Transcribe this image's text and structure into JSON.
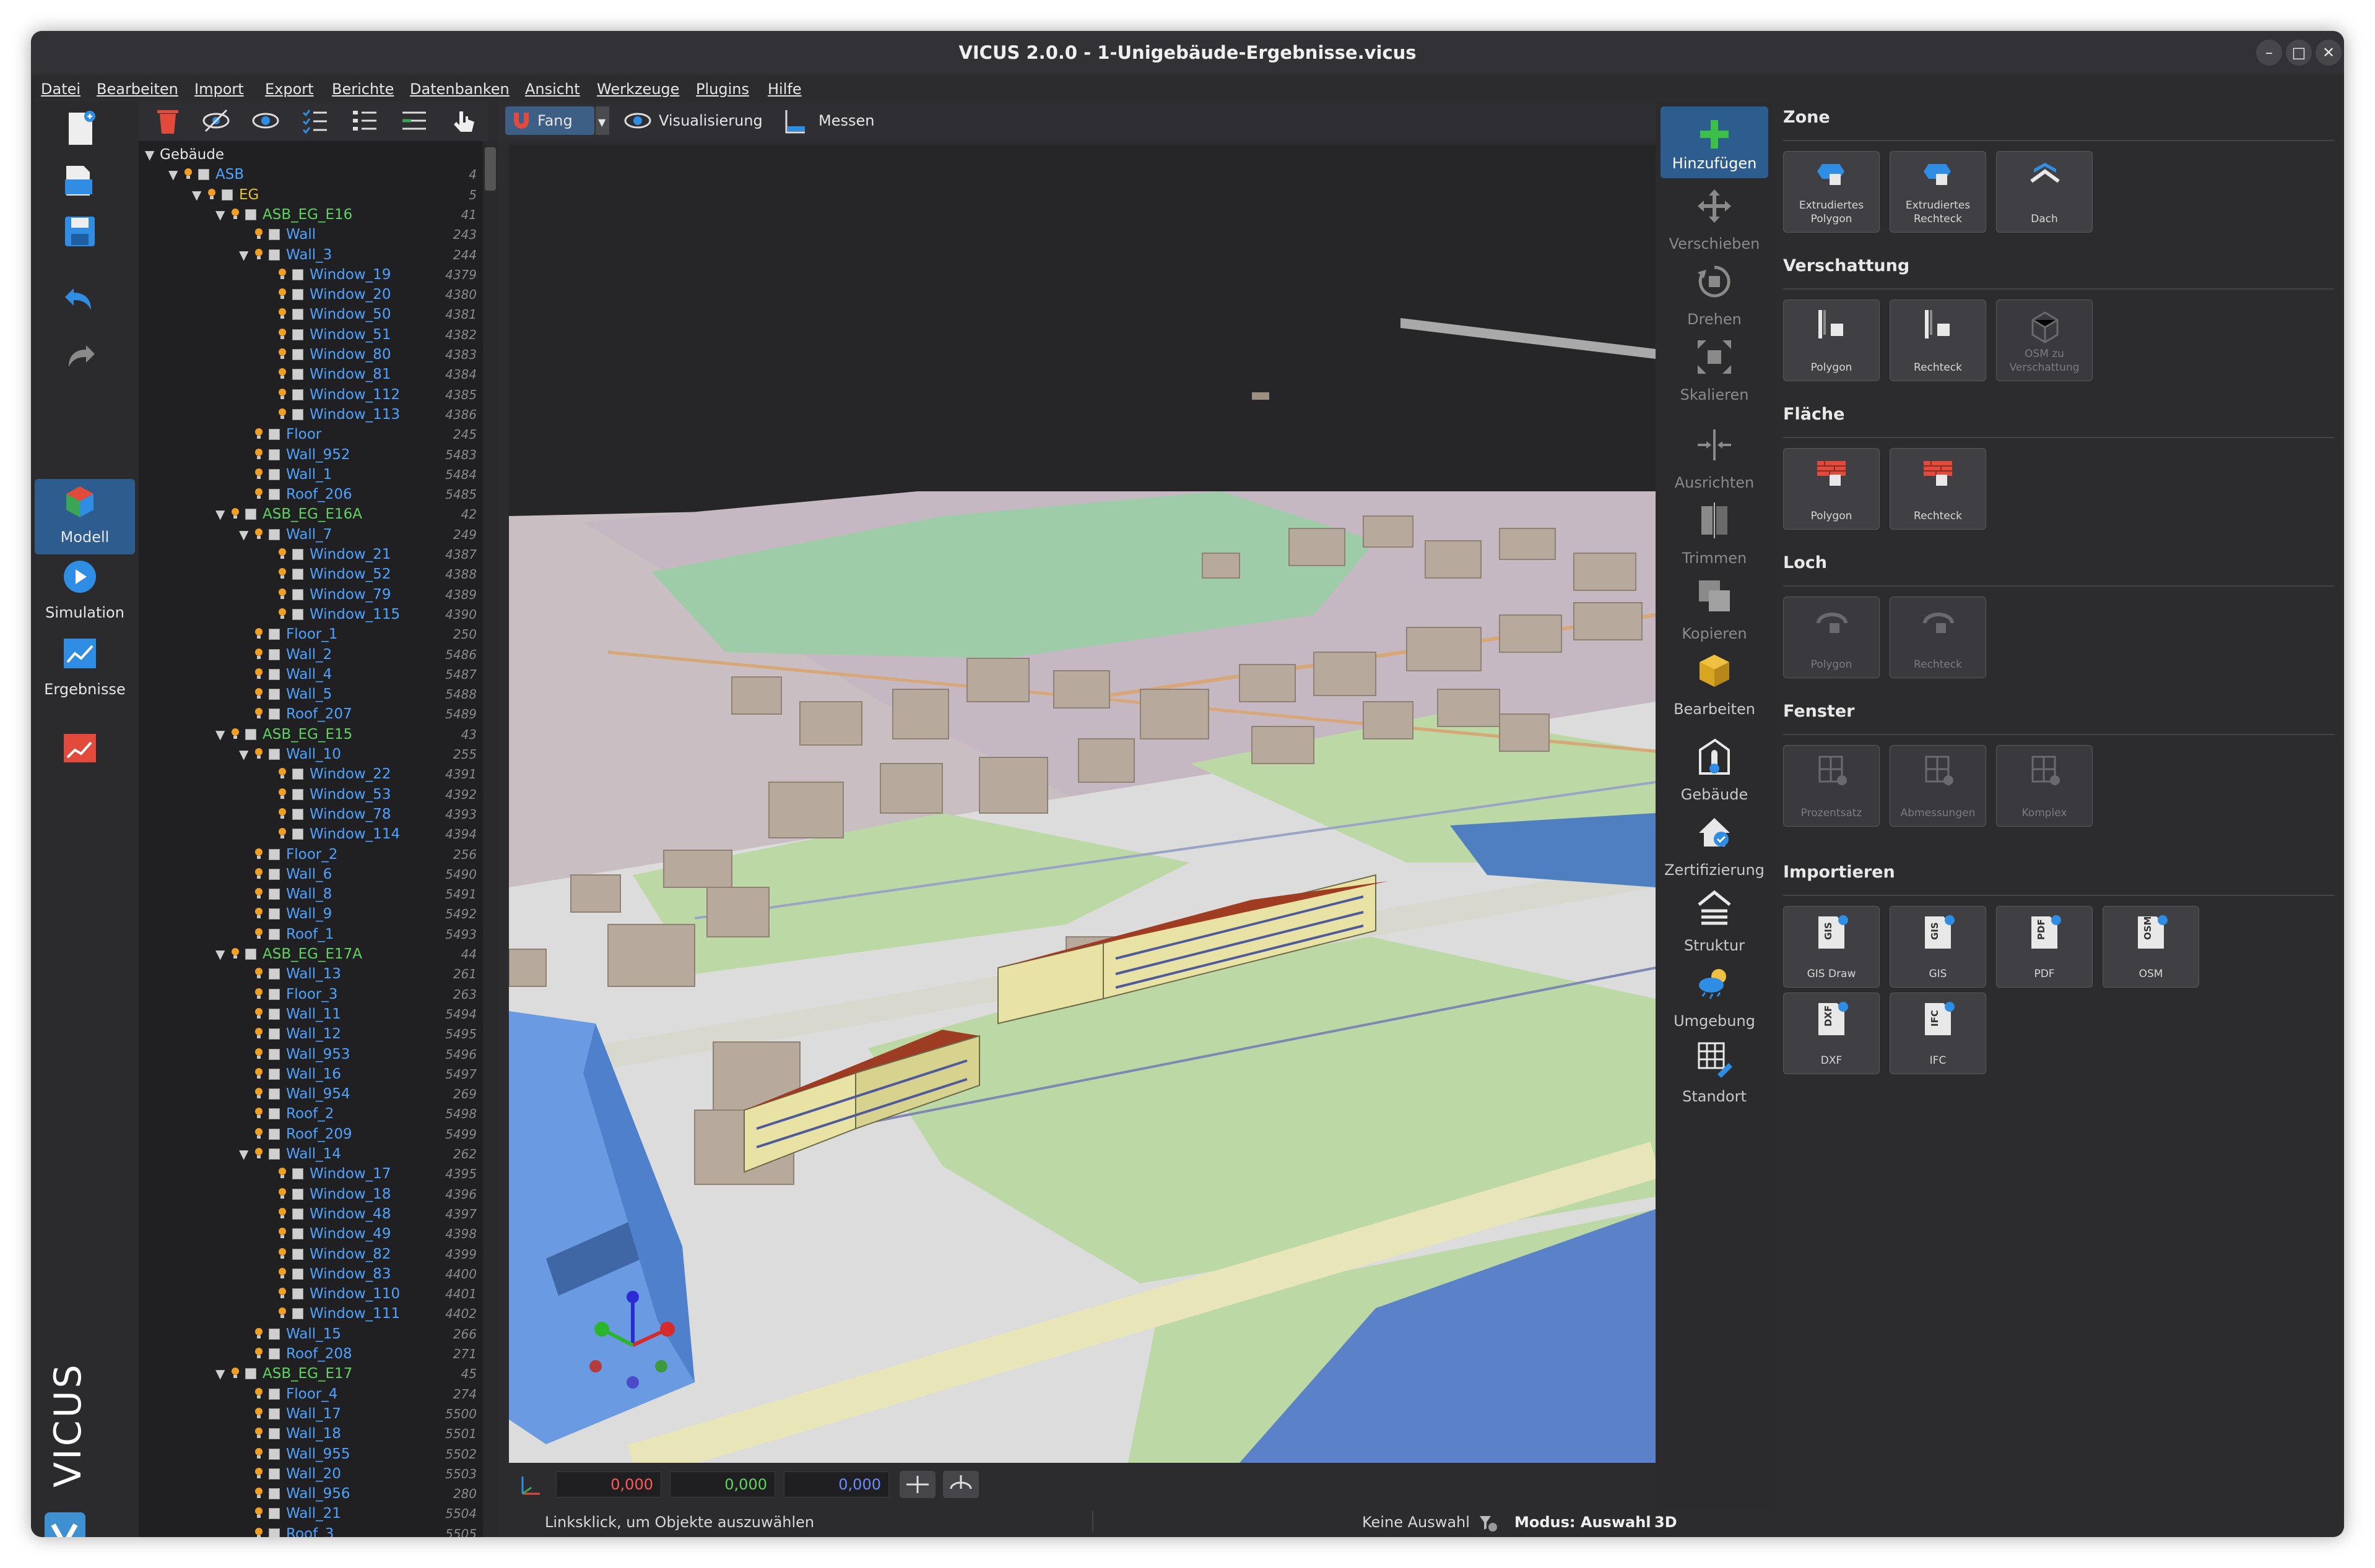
{
  "window": {
    "title": "VICUS 2.0.0 - 1-Unigebäude-Ergebnisse.vicus",
    "controls": [
      "–",
      "□",
      "✕"
    ]
  },
  "menu": [
    "Datei",
    "Bearbeiten",
    "Import",
    "Export",
    "Berichte",
    "Datenbanken",
    "Ansicht",
    "Werkzeuge",
    "Plugins",
    "Hilfe"
  ],
  "left_toolbar": {
    "modes": [
      "Modell",
      "Simulation",
      "Ergebnisse"
    ],
    "brand": "VICUS"
  },
  "view_toolbar": {
    "snap_label": "Fang",
    "visualization_label": "Visualisierung",
    "measure_label": "Messen"
  },
  "tree": [
    {
      "label": "Gebäude",
      "num": "",
      "level": 0,
      "arrow": true,
      "bulb": false,
      "box": false,
      "color": "#e6e6e6"
    },
    {
      "label": "ASB",
      "num": "4",
      "level": 1,
      "arrow": true,
      "bulb": true,
      "box": true,
      "color": "#4da3ff"
    },
    {
      "label": "EG",
      "num": "5",
      "level": 2,
      "arrow": true,
      "bulb": true,
      "box": true,
      "color": "#e6c229"
    },
    {
      "label": "ASB_EG_E16",
      "num": "41",
      "level": 3,
      "arrow": true,
      "bulb": true,
      "box": true,
      "color": "#5fd35f"
    },
    {
      "label": "Wall",
      "num": "243",
      "level": 4,
      "arrow": false,
      "bulb": true,
      "box": true,
      "color": "#4da3ff"
    },
    {
      "label": "Wall_3",
      "num": "244",
      "level": 4,
      "arrow": true,
      "bulb": true,
      "box": true,
      "color": "#4da3ff"
    },
    {
      "label": "Window_19",
      "num": "4379",
      "level": 5,
      "arrow": false,
      "bulb": true,
      "box": true,
      "color": "#4da3ff"
    },
    {
      "label": "Window_20",
      "num": "4380",
      "level": 5,
      "arrow": false,
      "bulb": true,
      "box": true,
      "color": "#4da3ff"
    },
    {
      "label": "Window_50",
      "num": "4381",
      "level": 5,
      "arrow": false,
      "bulb": true,
      "box": true,
      "color": "#4da3ff"
    },
    {
      "label": "Window_51",
      "num": "4382",
      "level": 5,
      "arrow": false,
      "bulb": true,
      "box": true,
      "color": "#4da3ff"
    },
    {
      "label": "Window_80",
      "num": "4383",
      "level": 5,
      "arrow": false,
      "bulb": true,
      "box": true,
      "color": "#4da3ff"
    },
    {
      "label": "Window_81",
      "num": "4384",
      "level": 5,
      "arrow": false,
      "bulb": true,
      "box": true,
      "color": "#4da3ff"
    },
    {
      "label": "Window_112",
      "num": "4385",
      "level": 5,
      "arrow": false,
      "bulb": true,
      "box": true,
      "color": "#4da3ff"
    },
    {
      "label": "Window_113",
      "num": "4386",
      "level": 5,
      "arrow": false,
      "bulb": true,
      "box": true,
      "color": "#4da3ff"
    },
    {
      "label": "Floor",
      "num": "245",
      "level": 4,
      "arrow": false,
      "bulb": true,
      "box": true,
      "color": "#4da3ff"
    },
    {
      "label": "Wall_952",
      "num": "5483",
      "level": 4,
      "arrow": false,
      "bulb": true,
      "box": true,
      "color": "#4da3ff"
    },
    {
      "label": "Wall_1",
      "num": "5484",
      "level": 4,
      "arrow": false,
      "bulb": true,
      "box": true,
      "color": "#4da3ff"
    },
    {
      "label": "Roof_206",
      "num": "5485",
      "level": 4,
      "arrow": false,
      "bulb": true,
      "box": true,
      "color": "#4da3ff"
    },
    {
      "label": "ASB_EG_E16A",
      "num": "42",
      "level": 3,
      "arrow": true,
      "bulb": true,
      "box": true,
      "color": "#5fd35f"
    },
    {
      "label": "Wall_7",
      "num": "249",
      "level": 4,
      "arrow": true,
      "bulb": true,
      "box": true,
      "color": "#4da3ff"
    },
    {
      "label": "Window_21",
      "num": "4387",
      "level": 5,
      "arrow": false,
      "bulb": true,
      "box": true,
      "color": "#4da3ff"
    },
    {
      "label": "Window_52",
      "num": "4388",
      "level": 5,
      "arrow": false,
      "bulb": true,
      "box": true,
      "color": "#4da3ff"
    },
    {
      "label": "Window_79",
      "num": "4389",
      "level": 5,
      "arrow": false,
      "bulb": true,
      "box": true,
      "color": "#4da3ff"
    },
    {
      "label": "Window_115",
      "num": "4390",
      "level": 5,
      "arrow": false,
      "bulb": true,
      "box": true,
      "color": "#4da3ff"
    },
    {
      "label": "Floor_1",
      "num": "250",
      "level": 4,
      "arrow": false,
      "bulb": true,
      "box": true,
      "color": "#4da3ff"
    },
    {
      "label": "Wall_2",
      "num": "5486",
      "level": 4,
      "arrow": false,
      "bulb": true,
      "box": true,
      "color": "#4da3ff"
    },
    {
      "label": "Wall_4",
      "num": "5487",
      "level": 4,
      "arrow": false,
      "bulb": true,
      "box": true,
      "color": "#4da3ff"
    },
    {
      "label": "Wall_5",
      "num": "5488",
      "level": 4,
      "arrow": false,
      "bulb": true,
      "box": true,
      "color": "#4da3ff"
    },
    {
      "label": "Roof_207",
      "num": "5489",
      "level": 4,
      "arrow": false,
      "bulb": true,
      "box": true,
      "color": "#4da3ff"
    },
    {
      "label": "ASB_EG_E15",
      "num": "43",
      "level": 3,
      "arrow": true,
      "bulb": true,
      "box": true,
      "color": "#5fd35f"
    },
    {
      "label": "Wall_10",
      "num": "255",
      "level": 4,
      "arrow": true,
      "bulb": true,
      "box": true,
      "color": "#4da3ff"
    },
    {
      "label": "Window_22",
      "num": "4391",
      "level": 5,
      "arrow": false,
      "bulb": true,
      "box": true,
      "color": "#4da3ff"
    },
    {
      "label": "Window_53",
      "num": "4392",
      "level": 5,
      "arrow": false,
      "bulb": true,
      "box": true,
      "color": "#4da3ff"
    },
    {
      "label": "Window_78",
      "num": "4393",
      "level": 5,
      "arrow": false,
      "bulb": true,
      "box": true,
      "color": "#4da3ff"
    },
    {
      "label": "Window_114",
      "num": "4394",
      "level": 5,
      "arrow": false,
      "bulb": true,
      "box": true,
      "color": "#4da3ff"
    },
    {
      "label": "Floor_2",
      "num": "256",
      "level": 4,
      "arrow": false,
      "bulb": true,
      "box": true,
      "color": "#4da3ff"
    },
    {
      "label": "Wall_6",
      "num": "5490",
      "level": 4,
      "arrow": false,
      "bulb": true,
      "box": true,
      "color": "#4da3ff"
    },
    {
      "label": "Wall_8",
      "num": "5491",
      "level": 4,
      "arrow": false,
      "bulb": true,
      "box": true,
      "color": "#4da3ff"
    },
    {
      "label": "Wall_9",
      "num": "5492",
      "level": 4,
      "arrow": false,
      "bulb": true,
      "box": true,
      "color": "#4da3ff"
    },
    {
      "label": "Roof_1",
      "num": "5493",
      "level": 4,
      "arrow": false,
      "bulb": true,
      "box": true,
      "color": "#4da3ff"
    },
    {
      "label": "ASB_EG_E17A",
      "num": "44",
      "level": 3,
      "arrow": true,
      "bulb": true,
      "box": true,
      "color": "#5fd35f"
    },
    {
      "label": "Wall_13",
      "num": "261",
      "level": 4,
      "arrow": false,
      "bulb": true,
      "box": true,
      "color": "#4da3ff"
    },
    {
      "label": "Floor_3",
      "num": "263",
      "level": 4,
      "arrow": false,
      "bulb": true,
      "box": true,
      "color": "#4da3ff"
    },
    {
      "label": "Wall_11",
      "num": "5494",
      "level": 4,
      "arrow": false,
      "bulb": true,
      "box": true,
      "color": "#4da3ff"
    },
    {
      "label": "Wall_12",
      "num": "5495",
      "level": 4,
      "arrow": false,
      "bulb": true,
      "box": true,
      "color": "#4da3ff"
    },
    {
      "label": "Wall_953",
      "num": "5496",
      "level": 4,
      "arrow": false,
      "bulb": true,
      "box": true,
      "color": "#4da3ff"
    },
    {
      "label": "Wall_16",
      "num": "5497",
      "level": 4,
      "arrow": false,
      "bulb": true,
      "box": true,
      "color": "#4da3ff"
    },
    {
      "label": "Wall_954",
      "num": "269",
      "level": 4,
      "arrow": false,
      "bulb": true,
      "box": true,
      "color": "#4da3ff"
    },
    {
      "label": "Roof_2",
      "num": "5498",
      "level": 4,
      "arrow": false,
      "bulb": true,
      "box": true,
      "color": "#4da3ff"
    },
    {
      "label": "Roof_209",
      "num": "5499",
      "level": 4,
      "arrow": false,
      "bulb": true,
      "box": true,
      "color": "#4da3ff"
    },
    {
      "label": "Wall_14",
      "num": "262",
      "level": 4,
      "arrow": true,
      "bulb": true,
      "box": true,
      "color": "#4da3ff"
    },
    {
      "label": "Window_17",
      "num": "4395",
      "level": 5,
      "arrow": false,
      "bulb": true,
      "box": true,
      "color": "#4da3ff"
    },
    {
      "label": "Window_18",
      "num": "4396",
      "level": 5,
      "arrow": false,
      "bulb": true,
      "box": true,
      "color": "#4da3ff"
    },
    {
      "label": "Window_48",
      "num": "4397",
      "level": 5,
      "arrow": false,
      "bulb": true,
      "box": true,
      "color": "#4da3ff"
    },
    {
      "label": "Window_49",
      "num": "4398",
      "level": 5,
      "arrow": false,
      "bulb": true,
      "box": true,
      "color": "#4da3ff"
    },
    {
      "label": "Window_82",
      "num": "4399",
      "level": 5,
      "arrow": false,
      "bulb": true,
      "box": true,
      "color": "#4da3ff"
    },
    {
      "label": "Window_83",
      "num": "4400",
      "level": 5,
      "arrow": false,
      "bulb": true,
      "box": true,
      "color": "#4da3ff"
    },
    {
      "label": "Window_110",
      "num": "4401",
      "level": 5,
      "arrow": false,
      "bulb": true,
      "box": true,
      "color": "#4da3ff"
    },
    {
      "label": "Window_111",
      "num": "4402",
      "level": 5,
      "arrow": false,
      "bulb": true,
      "box": true,
      "color": "#4da3ff"
    },
    {
      "label": "Wall_15",
      "num": "266",
      "level": 4,
      "arrow": false,
      "bulb": true,
      "box": true,
      "color": "#4da3ff"
    },
    {
      "label": "Roof_208",
      "num": "271",
      "level": 4,
      "arrow": false,
      "bulb": true,
      "box": true,
      "color": "#4da3ff"
    },
    {
      "label": "ASB_EG_E17",
      "num": "45",
      "level": 3,
      "arrow": true,
      "bulb": true,
      "box": true,
      "color": "#5fd35f"
    },
    {
      "label": "Floor_4",
      "num": "274",
      "level": 4,
      "arrow": false,
      "bulb": true,
      "box": true,
      "color": "#4da3ff"
    },
    {
      "label": "Wall_17",
      "num": "5500",
      "level": 4,
      "arrow": false,
      "bulb": true,
      "box": true,
      "color": "#4da3ff"
    },
    {
      "label": "Wall_18",
      "num": "5501",
      "level": 4,
      "arrow": false,
      "bulb": true,
      "box": true,
      "color": "#4da3ff"
    },
    {
      "label": "Wall_955",
      "num": "5502",
      "level": 4,
      "arrow": false,
      "bulb": true,
      "box": true,
      "color": "#4da3ff"
    },
    {
      "label": "Wall_20",
      "num": "5503",
      "level": 4,
      "arrow": false,
      "bulb": true,
      "box": true,
      "color": "#4da3ff"
    },
    {
      "label": "Wall_956",
      "num": "280",
      "level": 4,
      "arrow": false,
      "bulb": true,
      "box": true,
      "color": "#4da3ff"
    },
    {
      "label": "Wall_21",
      "num": "5504",
      "level": 4,
      "arrow": false,
      "bulb": true,
      "box": true,
      "color": "#4da3ff"
    },
    {
      "label": "Roof_3",
      "num": "5505",
      "level": 4,
      "arrow": false,
      "bulb": true,
      "box": true,
      "color": "#4da3ff"
    }
  ],
  "coords": {
    "x": "0,000",
    "y": "0,000",
    "z": "0,000",
    "x_color": "#ff5a5a",
    "y_color": "#5fd35f",
    "z_color": "#6a8cff"
  },
  "status": {
    "hint": "Linksklick, um Objekte auszuwählen",
    "selection": "Keine Auswahl",
    "mode": "Modus: Auswahl",
    "view": "3D"
  },
  "tools": [
    {
      "label": "Hinzufügen",
      "active": true
    },
    {
      "label": "Verschieben",
      "active": false
    },
    {
      "label": "Drehen",
      "active": false
    },
    {
      "label": "Skalieren",
      "active": false
    },
    {
      "label": "Ausrichten",
      "active": false
    },
    {
      "label": "Trimmen",
      "active": false
    },
    {
      "label": "Kopieren",
      "active": false
    },
    {
      "label": "Bearbeiten",
      "active": true
    },
    {
      "label": "Gebäude",
      "active": true
    },
    {
      "label": "Zertifizierung",
      "active": true
    },
    {
      "label": "Struktur",
      "active": true
    },
    {
      "label": "Umgebung",
      "active": true
    },
    {
      "label": "Standort",
      "active": true
    }
  ],
  "panel": {
    "sections": [
      {
        "title": "Zone",
        "buttons": [
          {
            "label": "Extrudiertes Polygon",
            "enabled": true,
            "icon": "extruded-polygon-icon"
          },
          {
            "label": "Extrudiertes Rechteck",
            "enabled": true,
            "icon": "extruded-rectangle-icon"
          },
          {
            "label": "Dach",
            "enabled": true,
            "icon": "roof-icon"
          }
        ]
      },
      {
        "title": "Verschattung",
        "buttons": [
          {
            "label": "Polygon",
            "enabled": true,
            "icon": "shading-polygon-icon"
          },
          {
            "label": "Rechteck",
            "enabled": true,
            "icon": "shading-rectangle-icon"
          },
          {
            "label": "OSM zu Verschattung",
            "enabled": false,
            "icon": "osm-shading-icon"
          }
        ]
      },
      {
        "title": "Fläche",
        "buttons": [
          {
            "label": "Polygon",
            "enabled": true,
            "icon": "surface-polygon-icon"
          },
          {
            "label": "Rechteck",
            "enabled": true,
            "icon": "surface-rectangle-icon"
          }
        ]
      },
      {
        "title": "Loch",
        "buttons": [
          {
            "label": "Polygon",
            "enabled": false,
            "icon": "hole-polygon-icon"
          },
          {
            "label": "Rechteck",
            "enabled": false,
            "icon": "hole-rectangle-icon"
          }
        ]
      },
      {
        "title": "Fenster",
        "buttons": [
          {
            "label": "Prozentsatz",
            "enabled": false,
            "icon": "window-percent-icon"
          },
          {
            "label": "Abmessungen",
            "enabled": false,
            "icon": "window-dimensions-icon"
          },
          {
            "label": "Komplex",
            "enabled": false,
            "icon": "window-complex-icon"
          }
        ]
      },
      {
        "title": "Importieren",
        "buttons": [
          {
            "label": "GIS Draw",
            "enabled": true,
            "icon": "gis-draw-icon",
            "tag": "GIS"
          },
          {
            "label": "GIS",
            "enabled": true,
            "icon": "gis-icon",
            "tag": "GIS"
          },
          {
            "label": "PDF",
            "enabled": true,
            "icon": "pdf-icon",
            "tag": "PDF"
          },
          {
            "label": "OSM",
            "enabled": true,
            "icon": "osm-icon",
            "tag": "OSM"
          },
          {
            "label": "DXF",
            "enabled": true,
            "icon": "dxf-icon",
            "tag": "DXF"
          },
          {
            "label": "IFC",
            "enabled": true,
            "icon": "ifc-icon",
            "tag": "IFC"
          }
        ]
      }
    ]
  }
}
